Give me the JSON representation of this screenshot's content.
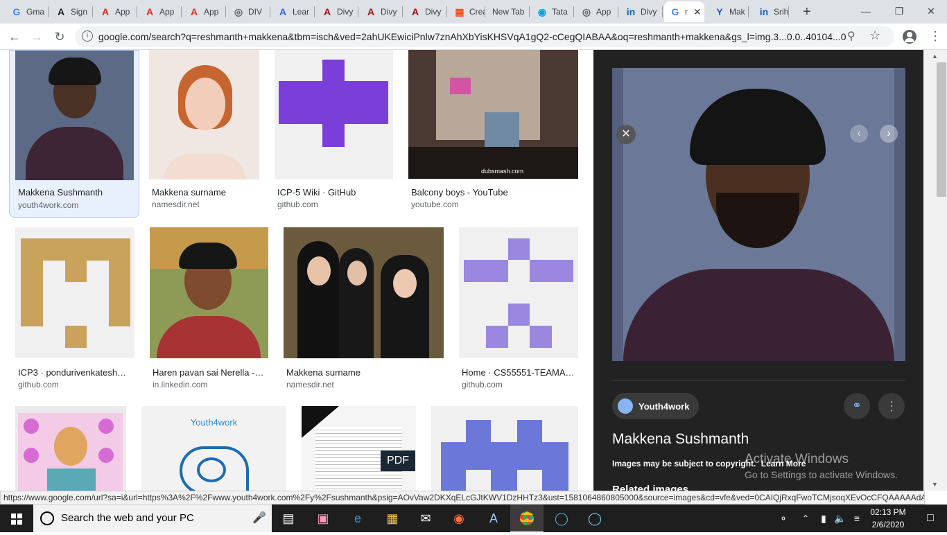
{
  "browser": {
    "tabs": [
      {
        "label": "Gma",
        "icon": "google-icon",
        "color": "#4285f4"
      },
      {
        "label": "Sign",
        "icon": "a-logo-icon",
        "color": "#222"
      },
      {
        "label": "App",
        "icon": "a-logo-red-icon",
        "color": "#d93025"
      },
      {
        "label": "App",
        "icon": "a-logo-red-icon",
        "color": "#d93025"
      },
      {
        "label": "App",
        "icon": "a-logo-red-icon",
        "color": "#d93025"
      },
      {
        "label": "DIV",
        "icon": "globe-icon",
        "color": "#5f6368"
      },
      {
        "label": "Lear",
        "icon": "a-logo-blue-icon",
        "color": "#3367d6"
      },
      {
        "label": "Divy",
        "icon": "a-logo-darkred-icon",
        "color": "#a50e0e"
      },
      {
        "label": "Divy",
        "icon": "a-logo-darkred-icon",
        "color": "#a50e0e"
      },
      {
        "label": "Divy",
        "icon": "a-logo-darkred-icon",
        "color": "#a50e0e"
      },
      {
        "label": "Crea",
        "icon": "microsoft-icon",
        "color": "#f25022"
      },
      {
        "label": "New Tab",
        "icon": "",
        "color": "#5f6368"
      },
      {
        "label": "Tata",
        "icon": "tata-icon",
        "color": "#00a3e0"
      },
      {
        "label": "App",
        "icon": "globe-icon",
        "color": "#5f6368"
      },
      {
        "label": "Divy",
        "icon": "linkedin-icon",
        "color": "#0a66c2"
      },
      {
        "label": "r",
        "icon": "google-icon",
        "color": "#4285f4",
        "active": true
      },
      {
        "label": "Mak",
        "icon": "y-logo-icon",
        "color": "#1565c0"
      },
      {
        "label": "Srih",
        "icon": "linkedin-icon",
        "color": "#0a66c2"
      }
    ],
    "new_tab_label": "+",
    "url": "google.com/search?q=reshmanth+makkena&tbm=isch&ved=2ahUKEwiciPnlw7znAhXbYisKHSVqA1gQ2-cCegQIABAA&oq=reshmanth+makkena&gs_l=img.3...0.0..40104...0..."
  },
  "results": [
    {
      "title": "Makkena Sushmanth",
      "source": "youth4work.com",
      "selected": true
    },
    {
      "title": "Makkena surname",
      "source": "namesdir.net"
    },
    {
      "title": "ICP-5 Wiki · GitHub",
      "source": "github.com"
    },
    {
      "title": "Balcony boys - YouTube",
      "source": "youtube.com",
      "watermark": "dubsmash.com"
    },
    {
      "title": "ICP3 · pondurivenkatesh…",
      "source": "github.com"
    },
    {
      "title": "Haren pavan sai Nerella -…",
      "source": "in.linkedin.com"
    },
    {
      "title": "Makkena surname",
      "source": "namesdir.net"
    },
    {
      "title": "Home · CS55551-TEAMA…",
      "source": "github.com"
    },
    {
      "title": "",
      "source": ""
    },
    {
      "title": "",
      "source": "",
      "thumb_text": "Youth4work"
    },
    {
      "title": "",
      "source": "",
      "badge": "PDF"
    },
    {
      "title": "",
      "source": ""
    }
  ],
  "panel": {
    "site_name": "Youth4work",
    "title": "Makkena Sushmanth",
    "copyright": "Images may be subject to copyright.",
    "learn_more": "Learn More",
    "related": "Related images"
  },
  "watermark": {
    "line1": "Activate Windows",
    "line2": "Go to Settings to activate Windows."
  },
  "status_url": "https://www.google.com/url?sa=i&url=https%3A%2F%2Fwww.youth4work.com%2Fy%2Fsushmanth&psig=AOvVaw2DKXqELcGJtKWV1DzHHTz3&ust=1581064860805000&source=images&cd=vfe&ved=0CAIQjRxqFwoTCMjsoqXEvOcCFQAAAAAdAA...",
  "taskbar": {
    "search_placeholder": "Search the web and your PC",
    "time": "02:13 PM",
    "date": "2/6/2020"
  }
}
